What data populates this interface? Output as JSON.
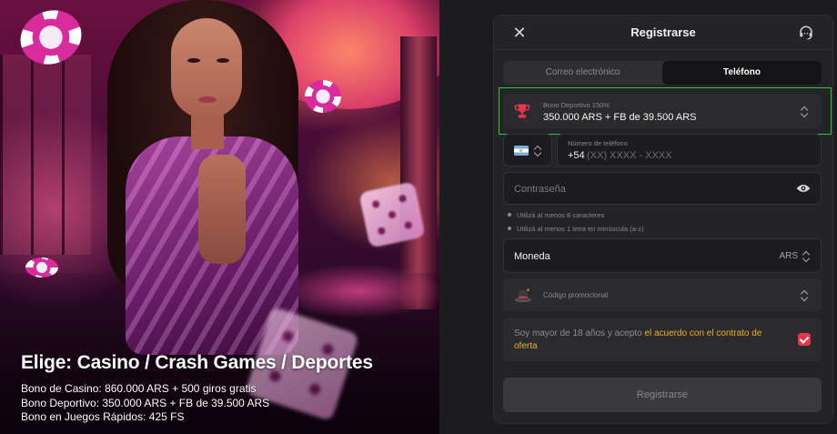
{
  "promo": {
    "title": "Elige: Casino / Crash Games / Deportes",
    "lines": [
      "Bono de Casino: 860.000 ARS + 500 giros gratis",
      "Bono Deportivo: 350.000 ARS + FB de 39.500 ARS",
      "Bono en Juegos Rápidos: 425 FS"
    ]
  },
  "modal": {
    "title": "Registrarse",
    "tabs": [
      {
        "label": "Correo electrónico",
        "active": false
      },
      {
        "label": "Teléfono",
        "active": true
      }
    ],
    "bonus": {
      "label": "Bono Deportivo 150%",
      "value": "350.000 ARS + FB de 39.500 ARS",
      "icon": "trophy-icon"
    },
    "phone": {
      "country_flag": "argentina-flag",
      "label": "Número de teléfono",
      "prefix": "+54",
      "placeholder": "(XX) XXXX - XXXX"
    },
    "password": {
      "placeholder": "Contraseña"
    },
    "hints": [
      "Utilizá al menos 8 caracteres",
      "Utilizá al menos 1 letra en minúscula (a-z)"
    ],
    "currency": {
      "label": "Moneda",
      "value": "ARS"
    },
    "promo_code": {
      "placeholder": "Código promocional"
    },
    "agreement": {
      "text": "Soy mayor de 18 años y acepto ",
      "link": "el acuerdo con el contrato de oferta",
      "checked": true
    },
    "submit_label": "Registrarse"
  },
  "colors": {
    "accent_red": "#e5354f",
    "link_yellow": "#e8b12b",
    "highlight_green": "#27c93f",
    "panel_bg": "#242426"
  }
}
